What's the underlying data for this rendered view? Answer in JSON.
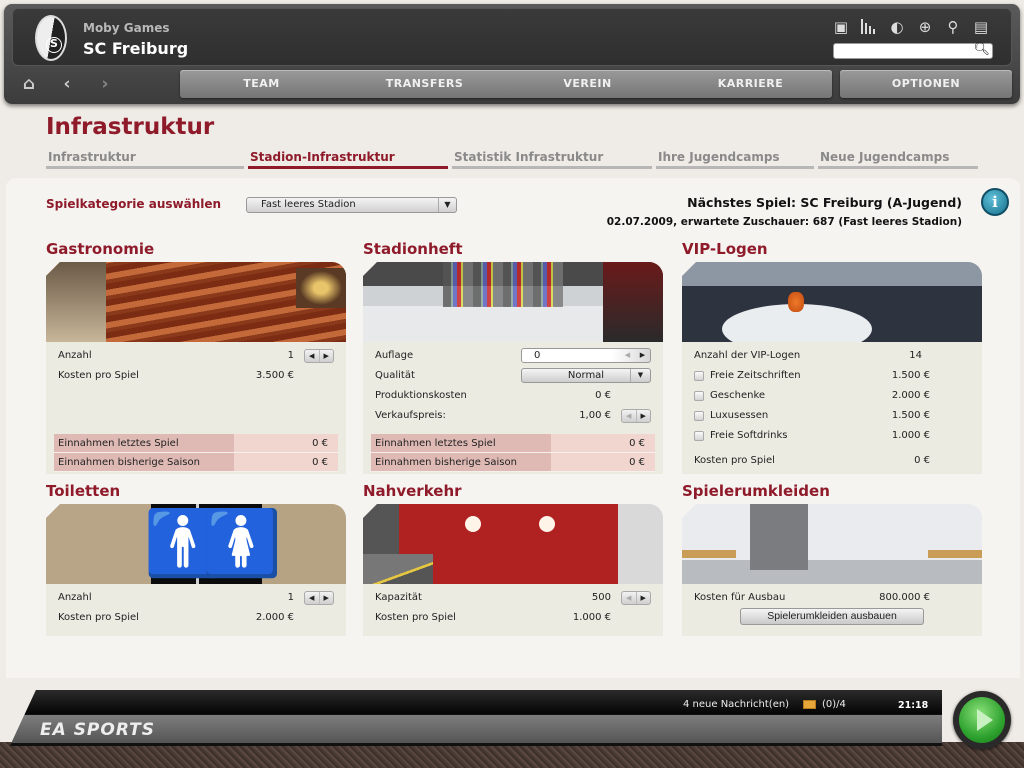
{
  "header": {
    "app_name": "Moby Games",
    "club_name": "SC Freiburg",
    "tool_icons": [
      {
        "name": "window-icon",
        "glyph": "▣"
      },
      {
        "name": "bar-chart-icon",
        "glyph": "▮"
      },
      {
        "name": "loading-circle-icon",
        "glyph": "◐"
      },
      {
        "name": "globe-icon",
        "glyph": "⊕"
      },
      {
        "name": "player-search-icon",
        "glyph": "⚲"
      },
      {
        "name": "document-search-icon",
        "glyph": "▤"
      }
    ],
    "search": {
      "value": "",
      "placeholder": ""
    },
    "nav": {
      "home": "⌂",
      "back": "‹",
      "forward": "›"
    },
    "tabs": [
      "TEAM",
      "TRANSFERS",
      "VEREIN",
      "KARRIERE"
    ],
    "options": "OPTIONEN"
  },
  "page": {
    "title": "Infrastruktur",
    "sub_tabs": [
      {
        "label": "Infrastruktur",
        "active": false
      },
      {
        "label": "Stadion-Infrastruktur",
        "active": true
      },
      {
        "label": "Statistik Infrastruktur",
        "active": false
      },
      {
        "label": "Ihre Jugendcamps",
        "active": false
      },
      {
        "label": "Neue Jugendcamps",
        "active": false
      }
    ]
  },
  "filter": {
    "label": "Spielkategorie auswählen",
    "selected": "Fast leeres Stadion"
  },
  "next_game": {
    "title": "Nächstes Spiel: SC Freiburg (A-Jugend)",
    "details": "02.07.2009, erwartete Zuschauer: 687 (Fast leeres Stadion)",
    "info": "i"
  },
  "cards": {
    "gastronomie": {
      "title": "Gastronomie",
      "rows": [
        {
          "label": "Anzahl",
          "value": "1"
        },
        {
          "label": "Kosten pro Spiel",
          "value": "3.500 €"
        }
      ],
      "income": [
        {
          "label": "Einnahmen letztes Spiel",
          "value": "0 €"
        },
        {
          "label": "Einnahmen bisherige Saison",
          "value": "0 €"
        }
      ]
    },
    "stadionheft": {
      "title": "Stadionheft",
      "auflage_label": "Auflage",
      "auflage_value": "0",
      "qualitaet_label": "Qualität",
      "qualitaet_value": "Normal",
      "produktionskosten_label": "Produktionskosten",
      "produktionskosten_value": "0 €",
      "verkaufspreis_label": "Verkaufspreis:",
      "verkaufspreis_value": "1,00 €",
      "income": [
        {
          "label": "Einnahmen letztes Spiel",
          "value": "0 €"
        },
        {
          "label": "Einnahmen bisherige Saison",
          "value": "0 €"
        }
      ]
    },
    "vip": {
      "title": "VIP-Logen",
      "count_label": "Anzahl der VIP-Logen",
      "count_value": "14",
      "options": [
        {
          "label": "Freie Zeitschriften",
          "value": "1.500 €",
          "checked": false
        },
        {
          "label": "Geschenke",
          "value": "2.000 €",
          "checked": false
        },
        {
          "label": "Luxusessen",
          "value": "1.500 €",
          "checked": false
        },
        {
          "label": "Freie Softdrinks",
          "value": "1.000 €",
          "checked": false
        }
      ],
      "cost_label": "Kosten pro Spiel",
      "cost_value": "0 €"
    },
    "toiletten": {
      "title": "Toiletten",
      "rows": [
        {
          "label": "Anzahl",
          "value": "1"
        },
        {
          "label": "Kosten pro Spiel",
          "value": "2.000 €"
        }
      ]
    },
    "nahverkehr": {
      "title": "Nahverkehr",
      "rows": [
        {
          "label": "Kapazität",
          "value": "500"
        },
        {
          "label": "Kosten pro Spiel",
          "value": "1.000 €"
        }
      ]
    },
    "umkleiden": {
      "title": "Spielerumkleiden",
      "cost_label": "Kosten für Ausbau",
      "cost_value": "800.000 €",
      "button": "Spielerumkleiden ausbauen"
    }
  },
  "footer": {
    "brand": "EA SPORTS",
    "messages": "4 neue Nachricht(en)",
    "mail_count": "(0)/4",
    "clock": "21:18"
  }
}
